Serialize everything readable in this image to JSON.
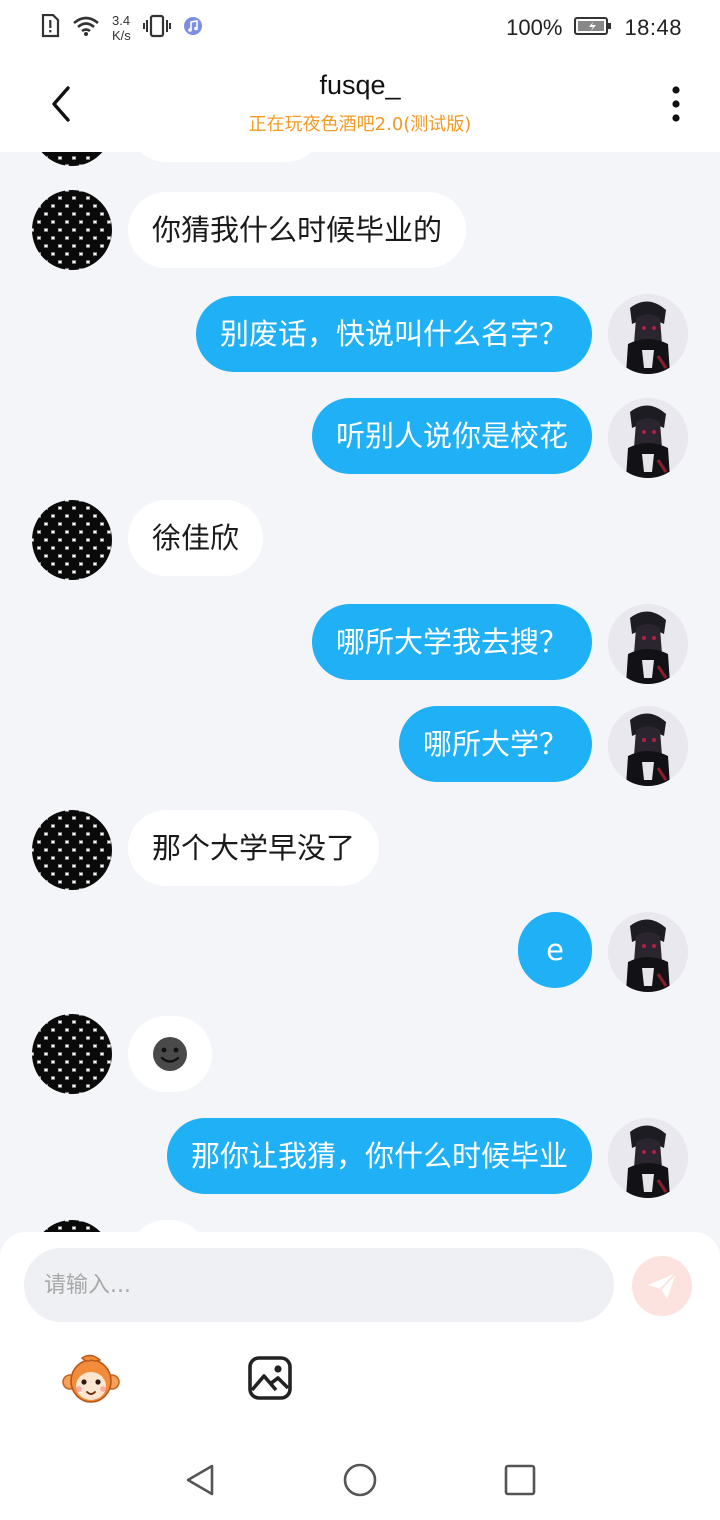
{
  "status_bar": {
    "speed_value": "3.4",
    "speed_unit": "K/s",
    "battery": "100%",
    "time": "18:48"
  },
  "header": {
    "title": "fusqe_",
    "subtitle": "正在玩夜色酒吧2.0(测试版)"
  },
  "messages": [
    {
      "side": "left",
      "text": "你猜我什么时候毕业的"
    },
    {
      "side": "right",
      "text": "别废话，快说叫什么名字？"
    },
    {
      "side": "right",
      "text": "听别人说你是校花"
    },
    {
      "side": "left",
      "text": "徐佳欣"
    },
    {
      "side": "right",
      "text": "哪所大学我去搜？"
    },
    {
      "side": "right",
      "text": "哪所大学？"
    },
    {
      "side": "left",
      "text": "那个大学早没了"
    },
    {
      "side": "right",
      "text": "e"
    },
    {
      "side": "left",
      "text": "",
      "emoji": "smiling-face"
    },
    {
      "side": "right",
      "text": "那你让我猜，你什么时候毕业"
    }
  ],
  "input": {
    "placeholder": "请输入..."
  },
  "colors": {
    "accent_orange": "#f29b24",
    "bubble_blue": "#1fb0f6",
    "send_button": "#fde3df",
    "chat_background": "#f3f5f9"
  },
  "icons": {
    "back": "chevron-left-icon",
    "more": "more-vertical-icon",
    "send": "paper-plane-icon",
    "emoji": "monkey-emoji-icon",
    "image": "image-icon"
  }
}
